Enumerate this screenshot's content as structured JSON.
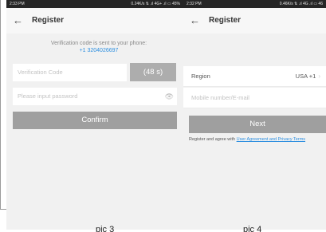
{
  "left_screen": {
    "status": {
      "time": "2:33 PM",
      "indicators": "0.24K/s ⇅ .ıl 4G+ .ıl ▭ 45%"
    },
    "title": "Register",
    "verification_text": "Verification code is sent to your phone:",
    "phone_number": "+1 3204026697",
    "code_placeholder": "Verification Code",
    "timer_label": "(48 s)",
    "password_placeholder": "Please input password",
    "confirm_label": "Confirm"
  },
  "right_screen": {
    "status": {
      "time": "2:32 PM",
      "indicators": "0.46K/s ⇅ .ıl 4G .ıl ▭ 46"
    },
    "title": "Register",
    "region_label": "Region",
    "region_value": "USA +1",
    "mobile_placeholder": "Mobile number/E-mail",
    "next_label": "Next",
    "agree_prefix": "Register and agree with ",
    "agree_link": "User Agreement and Privacy Terms"
  },
  "captions": {
    "left": "pic 3",
    "right": "pic 4"
  },
  "icons": {
    "back": "arrow-left-icon",
    "eye": "eye-icon",
    "chevron": "chevron-right-icon"
  },
  "colors": {
    "link": "#2d8fe0",
    "button": "#9f9f9f",
    "screen_bg": "#f1f1f1"
  }
}
